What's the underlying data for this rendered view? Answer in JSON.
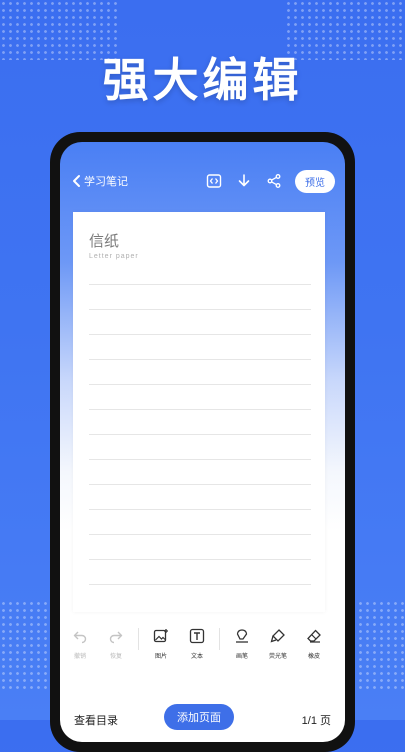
{
  "headline": "强大编辑",
  "header": {
    "back_label": "学习笔记",
    "preview_label": "预览",
    "icons": [
      "code-icon",
      "download-icon",
      "share-icon"
    ]
  },
  "paper": {
    "title": "信纸",
    "subtitle": "Letter paper"
  },
  "toolbar": {
    "undo": "撤销",
    "redo": "恢复",
    "image": "图片",
    "text": "文本",
    "pen": "画笔",
    "highlighter": "荧光笔",
    "eraser": "橡皮"
  },
  "bottom": {
    "toc_label": "查看目录",
    "add_page_label": "添加页面",
    "page_count": "1/1 页"
  },
  "colors": {
    "background": "#3f74f2",
    "accent": "#3e6fe8"
  }
}
